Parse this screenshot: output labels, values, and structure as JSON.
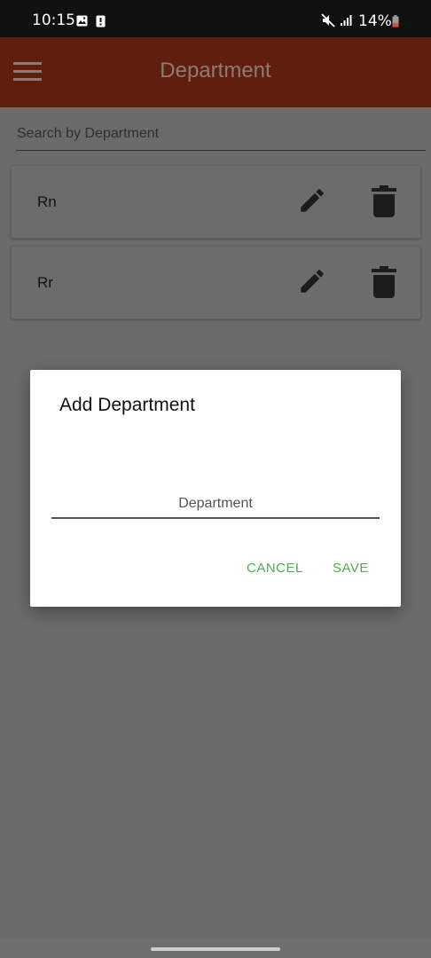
{
  "status_bar": {
    "time": "10:15",
    "battery_percent": "14%",
    "icons": [
      "image-icon",
      "alert-icon",
      "mute-icon",
      "signal-icon",
      "battery-icon"
    ]
  },
  "app_bar": {
    "title": "Department",
    "menu_icon": "hamburger-menu-icon"
  },
  "search": {
    "placeholder": "Search by Department"
  },
  "departments": [
    {
      "name": "Rn",
      "edit_icon": "pencil-icon",
      "delete_icon": "trash-icon"
    },
    {
      "name": "Rr",
      "edit_icon": "pencil-icon",
      "delete_icon": "trash-icon"
    }
  ],
  "dialog": {
    "title": "Add Department",
    "input_placeholder": "Department",
    "input_value": "",
    "cancel_label": "CANCEL",
    "save_label": "SAVE"
  },
  "colors": {
    "app_bar": "#601f0d",
    "dim_overlay": "#6b6b6b",
    "button_text": "#4caf50"
  }
}
